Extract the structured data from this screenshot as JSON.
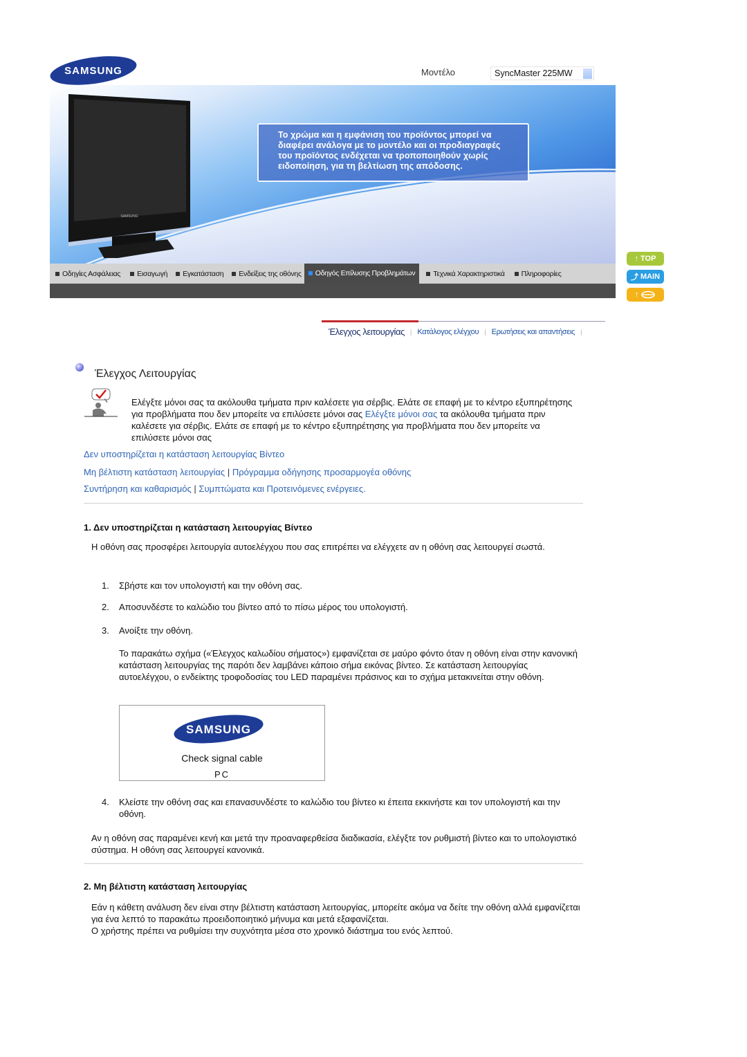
{
  "header": {
    "brand": "SAMSUNG",
    "model_label": "Μοντέλο",
    "model_value": "SyncMaster 225MW"
  },
  "banner": {
    "monitor_brand": "SAMSUNG",
    "notice_lines": [
      "Το χρώμα και η εμφάνιση του προϊόντος μπορεί να",
      "διαφέρει ανάλογα με το μοντέλο και οι προδιαγραφές",
      "του προϊόντος ενδέχεται να τροποποιηθούν χωρίς",
      "ειδοποίηση, για τη βελτίωση της απόδοσης."
    ]
  },
  "nav": {
    "items": [
      {
        "label": "Οδηγίες Ασφάλειας",
        "active": false
      },
      {
        "label": "Εισαγωγή",
        "active": false
      },
      {
        "label": "Εγκατάσταση",
        "active": false
      },
      {
        "label": "Ενδείξεις της οθόνης",
        "active": false
      },
      {
        "label": "Οδηγός Επίλυσης Προβλημάτων",
        "active": true
      },
      {
        "label": "Τεχνικά Χαρακτηριστικά",
        "active": false
      },
      {
        "label": "Πληροφορίες",
        "active": false
      }
    ]
  },
  "side_buttons": {
    "top": "TOP",
    "main": "MAIN",
    "back_icon": "return-icon"
  },
  "subtabs": [
    {
      "label": "Έλεγχος λειτουργίας",
      "active": true
    },
    {
      "label": "Κατάλογος ελέγχου",
      "active": false
    },
    {
      "label": "Ερωτήσεις και απαντήσεις",
      "active": false
    }
  ],
  "page": {
    "title": "Έλεγχος Λειτουργίας",
    "intro": {
      "part1": "Ελέγξτε μόνοι σας τα ακόλουθα τμήματα πριν καλέσετε για σέρβις. Ελάτε σε επαφή με το κέντρο εξυπηρέτησης για προβλήματα που δεν μπορείτε να επιλύσετε μόνοι σας ",
      "link": "Ελέγξτε μόνοι σας",
      "part2": " τα ακόλουθα τμήματα πριν καλέσετε για σέρβις. Ελάτε σε επαφή με το κέντρο εξυπηρέτησης για προβλήματα που δεν μπορείτε να επιλύσετε μόνοι σας"
    },
    "links": {
      "l1": "Δεν υποστηρίζεται η κατάσταση λειτουργίας Βίντεο",
      "l2a": "Μη βέλτιστη κατάσταση λειτουργίας",
      "l2b": "Πρόγραμμα οδήγησης προσαρμογέα οθόνης",
      "l3a": "Συντήρηση και καθαρισμός",
      "l3b": "Συμπτώματα και Προτεινόμενες ενέργειες.",
      "separator": "|"
    },
    "section1": {
      "heading": "1. Δεν υποστηρίζεται η κατάσταση λειτουργίας Βίντεο",
      "intro": "Η οθόνη σας προσφέρει λειτουργία αυτοελέγχου που σας επιτρέπει να ελέγχετε αν η οθόνη σας λειτουργεί σωστά.",
      "steps": [
        {
          "num": "1.",
          "text": "Σβήστε και τον υπολογιστή και την οθόνη σας."
        },
        {
          "num": "2.",
          "text": "Αποσυνδέστε το καλώδιο του βίντεο από το πίσω μέρος του υπολογιστή."
        },
        {
          "num": "3.",
          "text": "Ανοίξτε την οθόνη."
        },
        {
          "num": "4.",
          "text": "Κλείστε την οθόνη σας και επανασυνδέστε το καλώδιο του βίντεο κι έπειτα εκκινήστε και τον υπολογιστή και την οθόνη."
        }
      ],
      "step3_note": "Το παρακάτω σχήμα («Έλεγχος καλωδίου σήματος») εμφανίζεται σε μαύρο φόντο όταν η οθόνη είναι στην κανονική κατάσταση λειτουργίας της παρότι δεν λαμβάνει κάποιο σήμα εικόνας βίντεο. Σε κατάσταση λειτουργίας αυτοελέγχου, ο ενδείκτης τροφοδοσίας του LED παραμένει πράσινος και το σχήμα μετακινείται στην οθόνη.",
      "sample_screen": {
        "brand": "SAMSUNG",
        "message": "Check signal cable",
        "source": "PC"
      },
      "conclusion": "Αν η οθόνη σας παραμένει κενή και μετά την προαναφερθείσα διαδικασία, ελέγξτε τον ρυθμιστή βίντεο και το υπολογιστικό σύστημα. Η οθόνη σας λειτουργεί κανονικά."
    },
    "section2": {
      "heading": "2. Μη βέλτιστη κατάσταση λειτουργίας",
      "para1": "Εάν η κάθετη ανάλυση δεν είναι στην βέλτιστη κατάσταση λειτουργίας, μπορείτε ακόμα να δείτε την οθόνη αλλά εμφανίζεται για ένα λεπτό το παρακάτω προειδοποιητικό μήνυμα και μετά εξαφανίζεται.",
      "para2": "Ο χρήστης πρέπει να ρυθμίσει την συχνότητα μέσα στο χρονικό διάστημα του ενός λεπτού."
    }
  },
  "colors": {
    "link": "#2f64b5",
    "brand_blue": "#1e3c96",
    "nav_active_bg": "#4a4a4a",
    "subtab_active_line": "#c4282d",
    "btn_top": "#a8c83c",
    "btn_main": "#2a9ee3",
    "btn_back": "#f5b31a"
  }
}
